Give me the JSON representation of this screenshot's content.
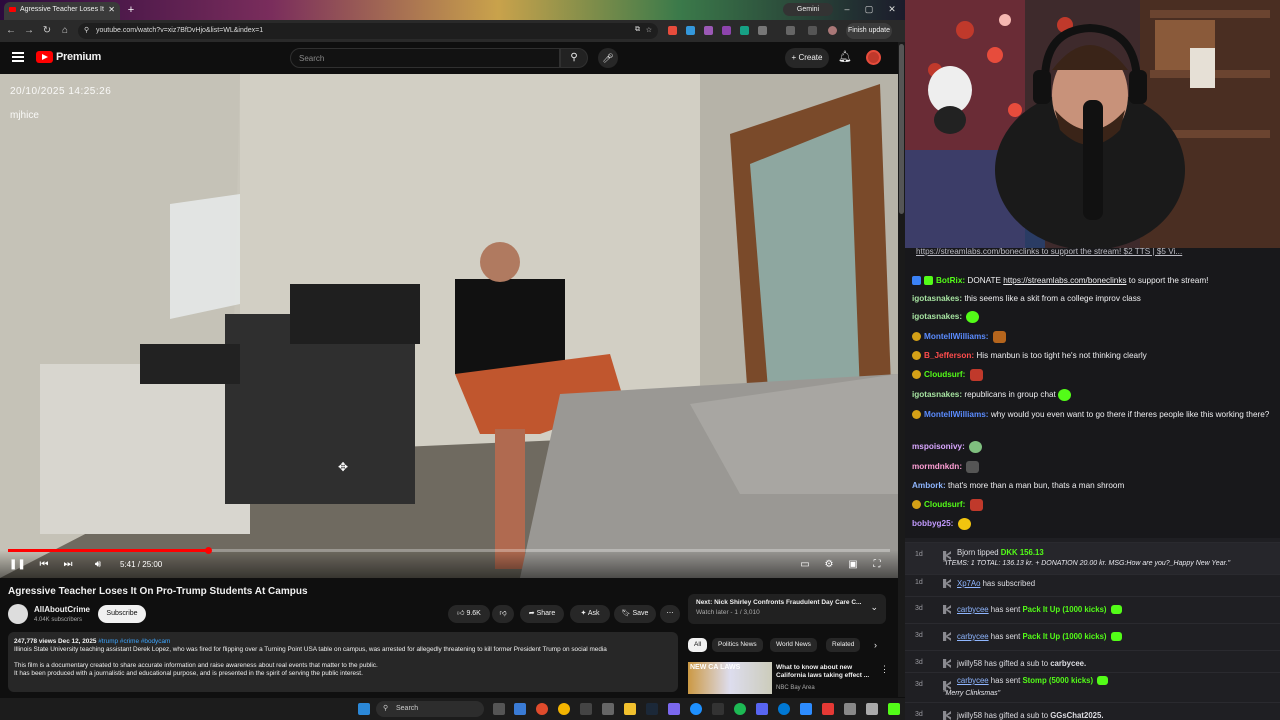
{
  "browser": {
    "tab_title": "Agressive Teacher Loses It",
    "gemini_label": "Gemini",
    "url": "youtube.com/watch?v=xiz7BfDvHjo&list=WL&index=1",
    "finish_update": "Finish update"
  },
  "youtube": {
    "logo_text": "Premium",
    "search_placeholder": "Search",
    "create_label": "Create",
    "video_overlay_timestamp": "20/10/2025 14:25:26",
    "video_overlay_cam": "mjhice",
    "time": "5:41 / 25:00",
    "progress_fraction": 0.227,
    "title": "Agressive Teacher Loses It On Pro-Trump Students At Campus",
    "channel": "AllAboutCrime",
    "subscribers": "4.04K subscribers",
    "subscribe": "Subscribe",
    "likes": "9.6K",
    "share": "Share",
    "ask": "Ask",
    "save": "Save",
    "views_date": "247,778 views  Dec 12, 2025",
    "hashtags": "#trump #crime #bodycam",
    "desc_line1": "Illinois State University teaching assistant Derek Lopez, who was fired for flipping over a Turning Point USA table on campus, was arrested for allegedly threatening to kill former President Trump on social media",
    "desc_line2": "This film is a documentary created to share accurate information and raise awareness about real events that matter to the public.",
    "desc_line3": "It has been produced with a journalistic and educational purpose, and is presented in the spirit of serving the public interest.",
    "next_label": "Next:",
    "next_title": "Nick Shirley Confronts Fraudulent Day Care C...",
    "next_sub": "Watch later - 1 / 3,010",
    "chips": [
      "All",
      "Politics News",
      "World News",
      "Related"
    ],
    "rec_thumb_text": "NEW CA LAWS",
    "rec_title": "What to know about new California laws taking effect ...",
    "rec_source": "NBC Bay Area"
  },
  "taskbar": {
    "search": "Search"
  },
  "chat": {
    "banner": "https://streamlabs.com/boneclinks to support the stream! $2 TTS | $5 Vi...",
    "messages": [
      {
        "user": "BotRix",
        "color": "#53fc18",
        "text": "DONATE https://streamlabs.com/boneclinks to support the stream!"
      },
      {
        "user": "igotasnakes",
        "color": "#a6e3a1",
        "text": "this seems like a skit from a college improv class"
      },
      {
        "user": "igotasnakes",
        "color": "#a6e3a1",
        "text": ""
      },
      {
        "user": "MontellWilliams",
        "color": "#5b8cff",
        "text": ""
      },
      {
        "user": "B_Jefferson",
        "color": "#ff4d4d",
        "text": "His manbun is too tight he's not thinking clearly"
      },
      {
        "user": "Cloudsurf",
        "color": "#53fc18",
        "text": ""
      },
      {
        "user": "igotasnakes",
        "color": "#a6e3a1",
        "text": "republicans in group chat"
      },
      {
        "user": "MontellWilliams",
        "color": "#5b8cff",
        "text": "why would you even want to go there if theres people like this working there?"
      },
      {
        "user": "mspoisonivy",
        "color": "#d9a7ff",
        "text": ""
      },
      {
        "user": "mormdnkdn",
        "color": "#ff9fd6",
        "text": ""
      },
      {
        "user": "Ambork",
        "color": "#8fb6ff",
        "text": "that's more than a man bun, thats a man shroom"
      },
      {
        "user": "Cloudsurf",
        "color": "#53fc18",
        "text": ""
      },
      {
        "user": "bobbyg25",
        "color": "#c39bff",
        "text": ""
      }
    ]
  },
  "events": [
    {
      "ago": "1d",
      "user": "Bjorn",
      "pre": "",
      "mid": " tipped ",
      "amount": "DKK 156.13",
      "sub": "\"ITEMS: 1 TOTAL: 136.13 kr. + DONATION 20.00 kr. MSG:How are you?_Happy New Year.\""
    },
    {
      "ago": "1d",
      "user": "Xp7Ao",
      "mid": " has subscribed",
      "amount": "",
      "sub": ""
    },
    {
      "ago": "3d",
      "user": "carbycee",
      "mid": " has sent ",
      "amount": "Pack It Up (1000 kicks)",
      "sub": ""
    },
    {
      "ago": "3d",
      "user": "carbycee",
      "mid": " has sent ",
      "amount": "Pack It Up (1000 kicks)",
      "sub": ""
    },
    {
      "ago": "3d",
      "user": "jwilly58",
      "mid": " has gifted a sub to ",
      "amount": "carbycee.",
      "sub": ""
    },
    {
      "ago": "3d",
      "user": "carbycee",
      "mid": " has sent ",
      "amount": "Stomp (5000 kicks)",
      "sub": "\"Merry Clinksmas\""
    },
    {
      "ago": "3d",
      "user": "jwilly58",
      "mid": " has gifted a sub to ",
      "amount": "GGsChat2025.",
      "sub": ""
    }
  ]
}
